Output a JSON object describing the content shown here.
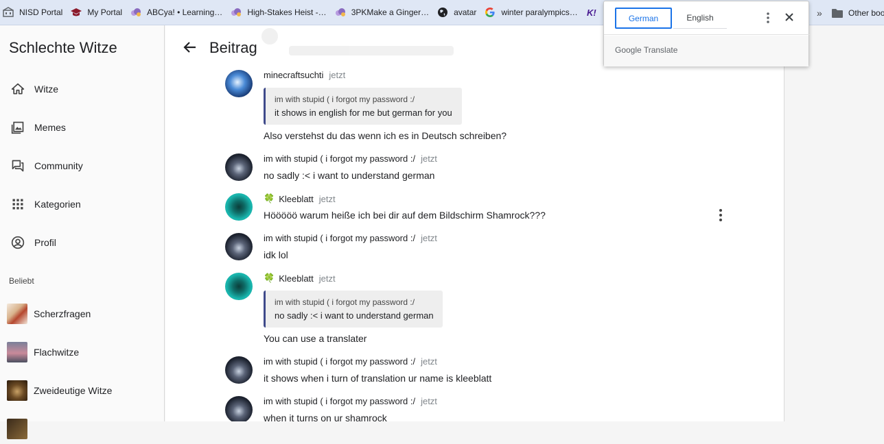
{
  "bookmarks": [
    {
      "label": "NISD Portal",
      "icon": "building-icon",
      "color": "#5f6368"
    },
    {
      "label": "My Portal",
      "icon": "grad-cap-icon",
      "color": "#8b1a2b"
    },
    {
      "label": "ABCya! • Learning…",
      "icon": "cloud-icon",
      "color": "#8a6bbf"
    },
    {
      "label": "High-Stakes Heist -…",
      "icon": "cloud-icon",
      "color": "#8a6bbf"
    },
    {
      "label": "3PKMake a Ginger…",
      "icon": "cloud-icon",
      "color": "#8a6bbf"
    },
    {
      "label": "avatar",
      "icon": "globe-icon",
      "color": "#202124"
    },
    {
      "label": "winter paralympics…",
      "icon": "google-icon",
      "color": "#4285f4"
    }
  ],
  "bookmarks_other": "Other boo",
  "sidebar": {
    "title": "Schlechte Witze",
    "nav": [
      {
        "label": "Witze",
        "icon": "home-icon"
      },
      {
        "label": "Memes",
        "icon": "image-icon"
      },
      {
        "label": "Community",
        "icon": "forum-icon"
      },
      {
        "label": "Kategorien",
        "icon": "grid-icon"
      },
      {
        "label": "Profil",
        "icon": "account-icon"
      }
    ],
    "section_label": "Beliebt",
    "favorites": [
      {
        "label": "Scherzfragen"
      },
      {
        "label": "Flachwitze"
      },
      {
        "label": "Zweideutige Witze"
      }
    ]
  },
  "main": {
    "title": "Beitrag",
    "messages": [
      {
        "author": "minecraftsuchti",
        "time": "jetzt",
        "quote_author": "im with stupid ( i forgot my password :/",
        "quote_text": "it shows in english for me but german for you",
        "text": "Also verstehst du das wenn ich es in Deutsch schreiben?"
      },
      {
        "author": "im with stupid ( i forgot my password :/",
        "time": "jetzt",
        "text": "no sadly :< i want to understand german"
      },
      {
        "author": "Kleeblatt",
        "time": "jetzt",
        "text": "Hööööö warum heiße ich bei dir auf dem Bildschirm Shamrock???"
      },
      {
        "author": "im with stupid ( i forgot my password :/",
        "time": "jetzt",
        "text": "idk lol"
      },
      {
        "author": "Kleeblatt",
        "time": "jetzt",
        "quote_author": "im with stupid ( i forgot my password :/",
        "quote_text": "no sadly :< i want to understand german",
        "text": "You can use a translater"
      },
      {
        "author": "im with stupid ( i forgot my password :/",
        "time": "jetzt",
        "text": "it shows when i turn of translation ur name is kleeblatt"
      },
      {
        "author": "im with stupid ( i forgot my password :/",
        "time": "jetzt",
        "text": "when it turns on ur shamrock"
      }
    ]
  },
  "translate": {
    "source_lang": "German",
    "target_lang": "English",
    "brand_google": "Google",
    "brand_translate": "Translate"
  },
  "colors": {
    "accent": "#1a73e8",
    "quote_border": "#3f4a8a",
    "clover": "#43a047"
  }
}
